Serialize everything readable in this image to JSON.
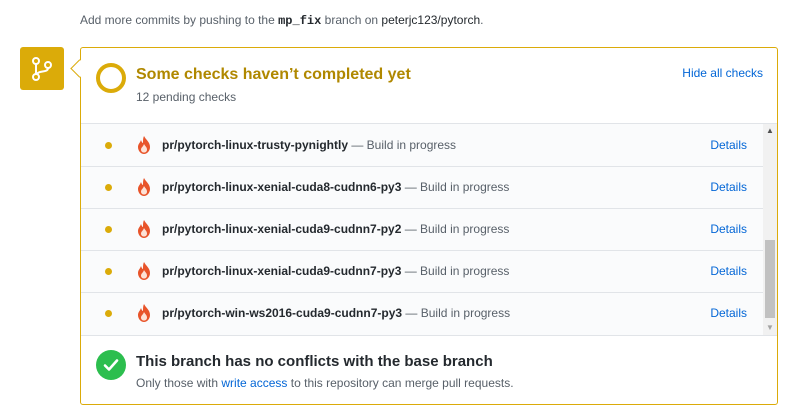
{
  "push_note": {
    "prefix": "Add more commits by pushing to the",
    "branch": "mp_fix",
    "middle": "branch on",
    "repo": "peterjc123/pytorch",
    "suffix": "."
  },
  "status": {
    "title": "Some checks haven’t completed yet",
    "subtitle": "12 pending checks",
    "toggle_label": "Hide all checks"
  },
  "checks": [
    {
      "name": "pr/pytorch-linux-trusty-pynightly",
      "status": "— Build in progress",
      "details": "Details"
    },
    {
      "name": "pr/pytorch-linux-xenial-cuda8-cudnn6-py3",
      "status": "— Build in progress",
      "details": "Details"
    },
    {
      "name": "pr/pytorch-linux-xenial-cuda9-cudnn7-py2",
      "status": "— Build in progress",
      "details": "Details"
    },
    {
      "name": "pr/pytorch-linux-xenial-cuda9-cudnn7-py3",
      "status": "— Build in progress",
      "details": "Details"
    },
    {
      "name": "pr/pytorch-win-ws2016-cuda9-cudnn7-py3",
      "status": "— Build in progress",
      "details": "Details"
    }
  ],
  "merge": {
    "title": "This branch has no conflicts with the base branch",
    "sub_prefix": "Only those with",
    "sub_link": "write access",
    "sub_suffix": "to this repository can merge pull requests."
  },
  "icons": {
    "branch": "git-branch-icon",
    "pending": "pending-dot-icon",
    "jenkins": "jenkins-flame-icon",
    "check": "check-icon"
  },
  "colors": {
    "pending": "#dbab09",
    "pending_text": "#b08800",
    "link": "#0366d6",
    "success": "#2cbe4e"
  }
}
